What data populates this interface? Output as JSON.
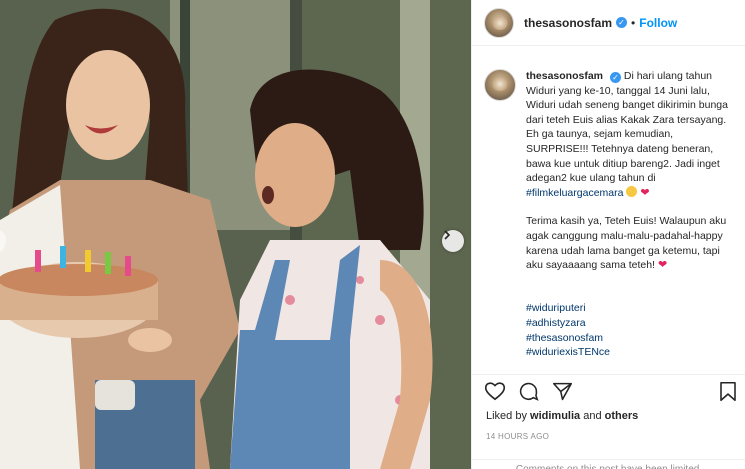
{
  "header": {
    "username": "thesasonosfam",
    "separator": "•",
    "follow_label": "Follow",
    "verified_icon": "✓"
  },
  "caption": {
    "username": "thesasonosfam",
    "text_1": "Di hari ulang tahun Widuri yang ke-10, tanggal 14 Juni lalu, Widuri udah seneng banget dikirimin bunga dari teteh Euis alias Kakak Zara tersayang. Eh ga taunya, sejam kemudian, SURPRISE!!! Tetehnya dateng beneran, bawa kue untuk ditiup bareng2. Jadi inget adegan2 kue ulang tahun di",
    "hashtag_1": "#filmkeluargacemara",
    "text_2": "Terima kasih ya, Teteh Euis! Walaupun aku agak canggung malu-malu-padahal-happy karena udah lama banget ga ketemu, tapi aku sayaaaang sama teteh!",
    "hashtags": [
      "#widuriputeri",
      "#adhistyzara",
      "#thesasonosfam",
      "#widuriexisTENce"
    ],
    "emojis": [
      "smiling-face-emoji",
      "red-heart-emoji"
    ]
  },
  "actions": {
    "icons": [
      "heart-icon",
      "comment-icon",
      "share-icon",
      "bookmark-icon"
    ],
    "liked_by_prefix": "Liked by",
    "liked_by_user": "widimulia",
    "liked_by_and": "and",
    "liked_by_others": "others",
    "timestamp": "14 HOURS AGO",
    "comments_notice": "Comments on this post have been limited."
  },
  "colors": {
    "link_blue": "#0095f6",
    "hashtag_blue": "#00376b",
    "verified_blue": "#3897f0",
    "heart_red": "#e0245e",
    "muted_gray": "#8e8e8e"
  }
}
